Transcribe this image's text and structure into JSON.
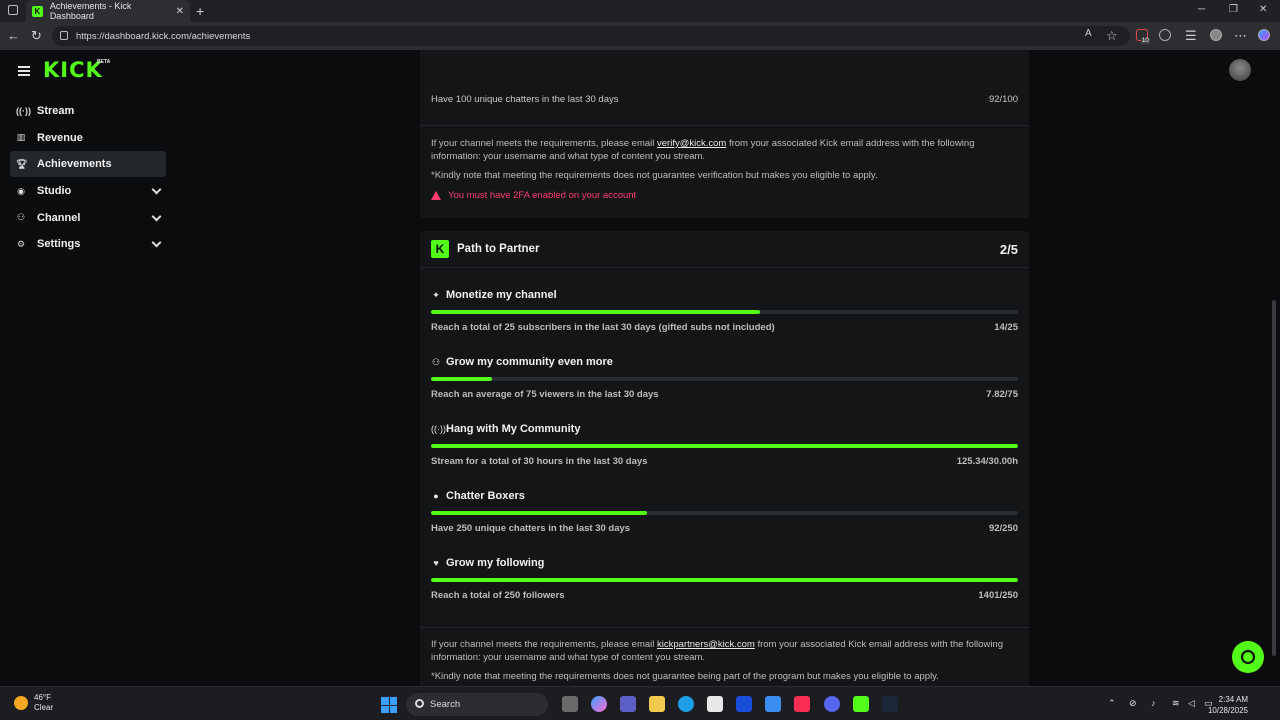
{
  "browser": {
    "tab_title": "Achievements - Kick Dashboard",
    "url": "https://dashboard.kick.com/achievements",
    "extension_badge": "10"
  },
  "header": {
    "logo": "KICK",
    "beta": "BETA"
  },
  "sidebar": {
    "items": [
      {
        "label": "Stream",
        "icon": "broadcast-icon"
      },
      {
        "label": "Revenue",
        "icon": "chart-icon"
      },
      {
        "label": "Achievements",
        "icon": "trophy-icon"
      },
      {
        "label": "Studio",
        "icon": "studio-icon"
      },
      {
        "label": "Channel",
        "icon": "users-icon"
      },
      {
        "label": "Settings",
        "icon": "gear-icon"
      }
    ]
  },
  "verification": {
    "last_goal_desc": "Have 100 unique chatters in the last 30 days",
    "last_goal_value": "92/100",
    "para1_pre": "If your channel meets the requirements, please email ",
    "para1_link": "verify@kick.com",
    "para1_post": " from your associated Kick email address with the following information: your username and what type of content you stream.",
    "note": "*Kindly note that meeting the requirements does not guarantee verification but makes you eligible to apply.",
    "warning": "You must have 2FA enabled on your account"
  },
  "partner": {
    "title": "Path to Partner",
    "count": "2/5",
    "goals": [
      {
        "icon": "sparkle-icon",
        "title": "Monetize my channel",
        "desc": "Reach a total of 25 subscribers in the last 30 days (gifted subs not included)",
        "value": "14/25",
        "progress": 0.56
      },
      {
        "icon": "group-icon",
        "title": "Grow my community even more",
        "desc": "Reach an average of 75 viewers in the last 30 days",
        "value": "7.82/75",
        "progress": 0.104
      },
      {
        "icon": "broadcast-icon",
        "title": "Hang with My Community",
        "desc": "Stream for a total of 30 hours in the last 30 days",
        "value": "125.34/30.00h",
        "progress": 1.0
      },
      {
        "icon": "chat-icon",
        "title": "Chatter Boxers",
        "desc": "Have 250 unique chatters in the last 30 days",
        "value": "92/250",
        "progress": 0.368
      },
      {
        "icon": "heart-icon",
        "title": "Grow my following",
        "desc": "Reach a total of 250 followers",
        "value": "1401/250",
        "progress": 1.0
      }
    ],
    "para_pre": "If your channel meets the requirements, please email ",
    "para_link": "kickpartners@kick.com",
    "para_post": " from your associated Kick email address with the following information: your username and what type of content you stream.",
    "note": "*Kindly note that meeting the requirements does not guarantee being part of the program but makes you eligible to apply."
  },
  "taskbar": {
    "temp": "46°F",
    "condition": "Clear",
    "search": "Search",
    "time": "2:34 AM",
    "date": "10/28/2025"
  },
  "colors": {
    "accent": "#53fc18",
    "warning": "#ff3d6e"
  }
}
